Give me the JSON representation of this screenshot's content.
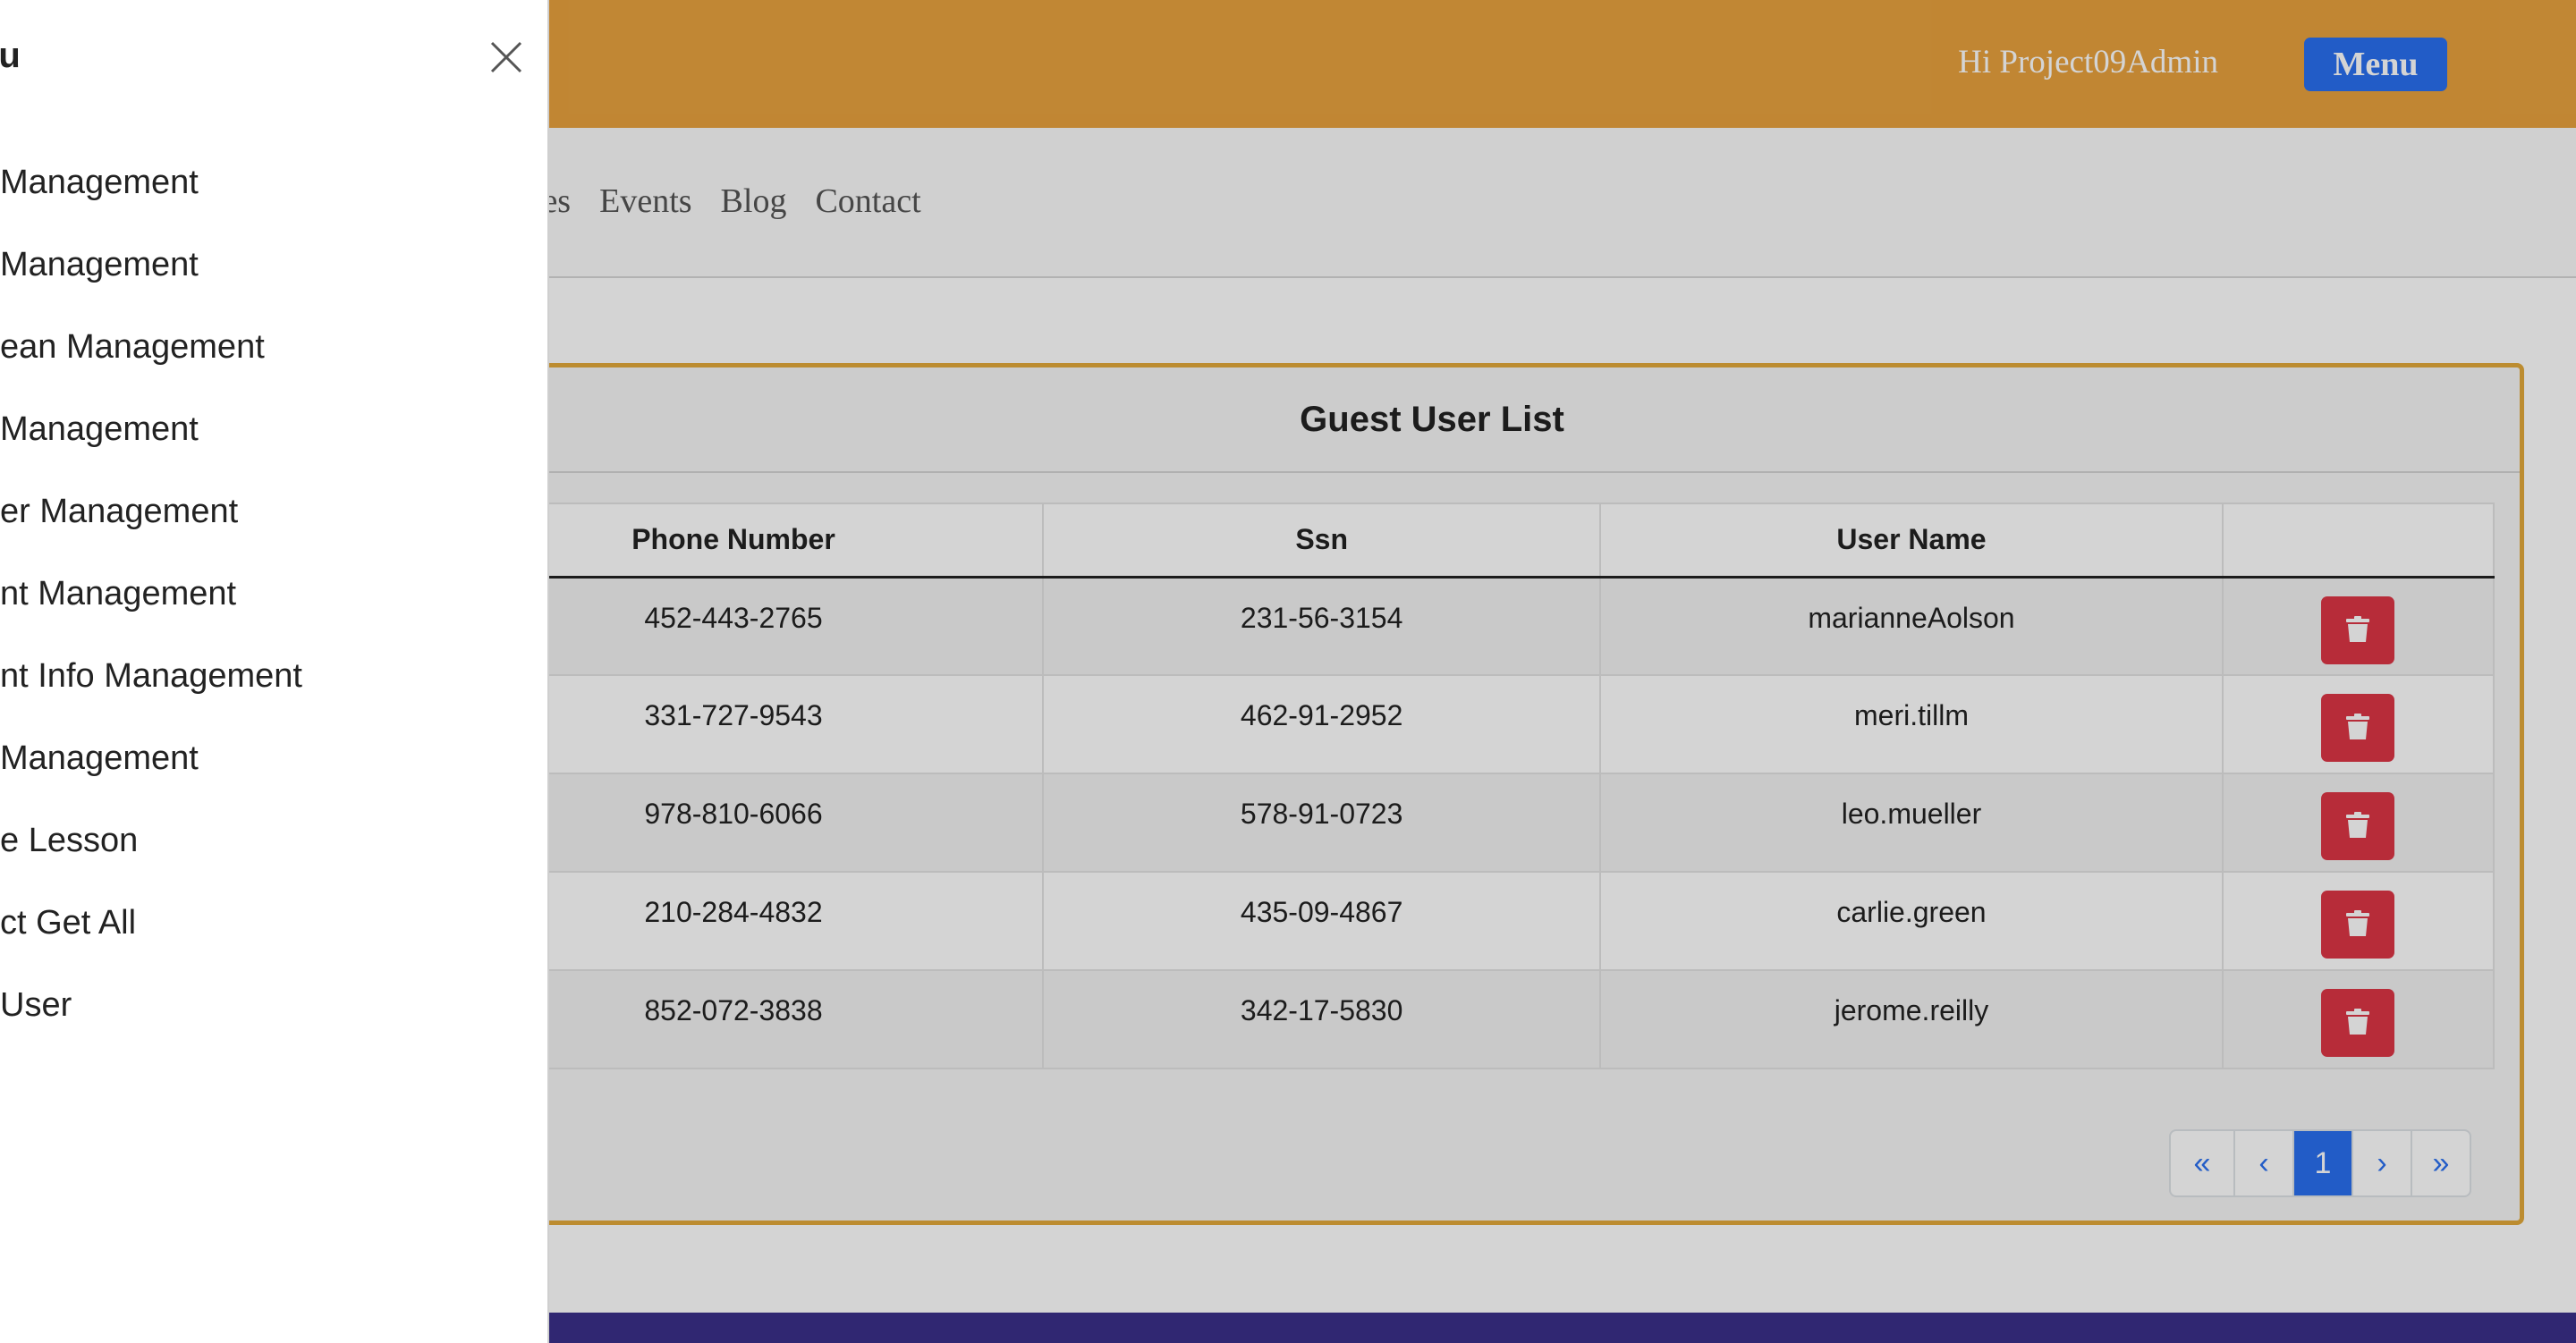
{
  "header": {
    "greeting": "Hi Project09Admin",
    "menu_button": "Menu"
  },
  "nav": {
    "links": [
      "urses",
      "Events",
      "Blog",
      "Contact"
    ]
  },
  "guest_list": {
    "title": "Guest User List",
    "columns": [
      "",
      "Phone Number",
      "Ssn",
      "User Name",
      ""
    ],
    "rows": [
      {
        "phone": "452-443-2765",
        "ssn": "231-56-3154",
        "username": "marianneAolson"
      },
      {
        "phone": "331-727-9543",
        "ssn": "462-91-2952",
        "username": "meri.tillm"
      },
      {
        "phone": "978-810-6066",
        "ssn": "578-91-0723",
        "username": "leo.mueller"
      },
      {
        "phone": "210-284-4832",
        "ssn": "435-09-4867",
        "username": "carlie.green"
      },
      {
        "phone": "852-072-3838",
        "ssn": "342-17-5830",
        "username": "jerome.reilly"
      }
    ],
    "delete_icon": "trash-icon"
  },
  "pagination": {
    "first": "«",
    "prev": "‹",
    "current": "1",
    "next": "›",
    "last": "»"
  },
  "offcanvas": {
    "title": "nu",
    "close_icon": "close-icon",
    "items": [
      "Management",
      "Management",
      "ean Management",
      "Management",
      "er Management",
      "nt Management",
      "nt Info Management",
      "Management",
      "e Lesson",
      "ct Get All",
      "User",
      ""
    ]
  },
  "colors": {
    "topbar": "#e8a23e",
    "menu_button": "#2a6ff0",
    "card_border": "#e2a93a",
    "delete_button": "#dc3545",
    "footer": "#3a2f8a"
  }
}
